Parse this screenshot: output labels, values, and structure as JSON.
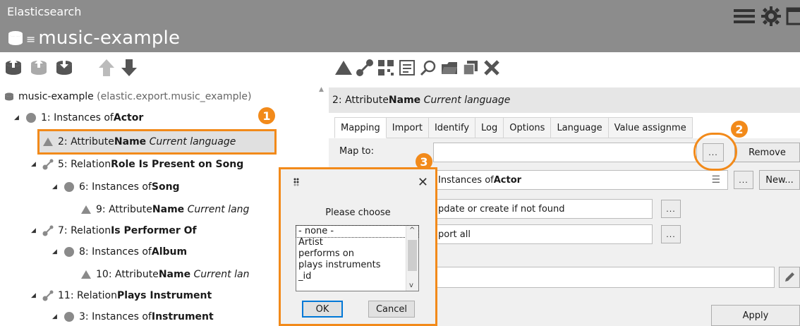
{
  "header": {
    "app_title": "Elasticsearch",
    "db_name": "music-example"
  },
  "icons": {
    "database": "database-icon",
    "menu": "menu-icon",
    "hamburger": "hamburger-icon",
    "settings": "gear-icon",
    "window": "window-icon"
  },
  "tree": {
    "root_label": "music-example",
    "root_sub": "(elastic.export.music_example)",
    "rows": [
      {
        "pre": "1: Instances of ",
        "bold": "Actor",
        "post": ""
      },
      {
        "pre": "2: Attribute ",
        "bold": "Name",
        "post": "Current language"
      },
      {
        "pre": "5: Relation ",
        "bold": "Role Is Present on Song",
        "post": ""
      },
      {
        "pre": "6: Instances of ",
        "bold": "Song",
        "post": ""
      },
      {
        "pre": "9: Attribute ",
        "bold": "Name",
        "post": "Current lang"
      },
      {
        "pre": "7: Relation ",
        "bold": "Is Performer Of",
        "post": ""
      },
      {
        "pre": "8: Instances of ",
        "bold": "Album",
        "post": ""
      },
      {
        "pre": "10: Attribute ",
        "bold": "Name",
        "post": "Current lan"
      },
      {
        "pre": "11: Relation ",
        "bold": "Plays Instrument",
        "post": ""
      },
      {
        "pre": "3: Instances of ",
        "bold": "Instrument",
        "post": ""
      }
    ]
  },
  "panel": {
    "title_pre": "2: Attribute ",
    "title_bold": "Name",
    "title_post": "Current language",
    "tabs": [
      "Mapping",
      "Import",
      "Identify",
      "Log",
      "Options",
      "Language",
      "Value assignme"
    ],
    "map_to_label": "Map to:",
    "map_to_value": "",
    "ellipsis": "...",
    "remove": "Remove",
    "instances_pre": "Instances of ",
    "instances_bold": "Actor",
    "new": "New...",
    "update_mode": "pdate or create if not found",
    "export_mode": "port all",
    "apply": "Apply"
  },
  "callouts": [
    "1",
    "2",
    "3"
  ],
  "dialog": {
    "prompt": "Please choose",
    "options": [
      "- none -",
      "Artist",
      "performs on",
      "plays instruments",
      "_id"
    ],
    "selected_index": 0,
    "ok": "OK",
    "cancel": "Cancel",
    "close": "✕"
  },
  "colors": {
    "header_bg": "#8c8c8c",
    "highlight": "#f28a1a",
    "toolbar_icon": "#555555",
    "node_circle": "#8a8a8a"
  }
}
